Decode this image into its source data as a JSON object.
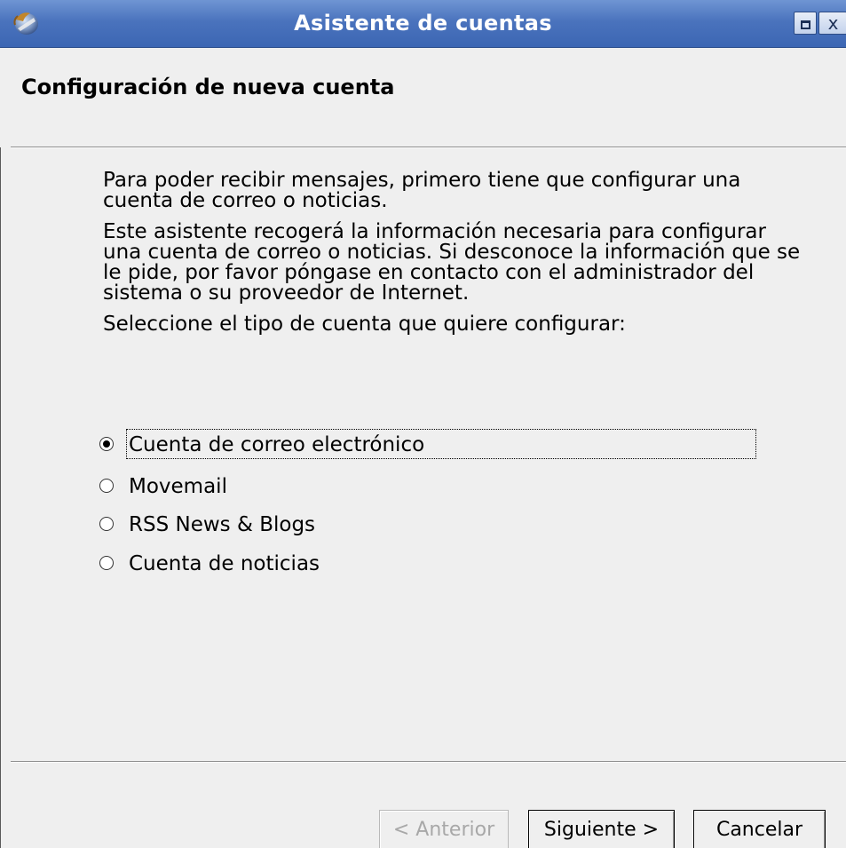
{
  "window": {
    "title": "Asistente de cuentas",
    "icon": "thunderbird-app-icon",
    "maximize_icon": "maximize-icon",
    "close_label": "x"
  },
  "header": {
    "title": "Configuración de nueva cuenta"
  },
  "content": {
    "intro": "Para poder recibir mensajes, primero tiene que configurar una cuenta de correo o noticias.",
    "description": "Este asistente recogerá la información necesaria para configurar una cuenta de correo o noticias. Si desconoce la información que se le pide, por favor póngase en contacto con el administrador del sistema o su proveedor de Internet.",
    "select_label": "Seleccione el tipo de cuenta que quiere configurar:"
  },
  "account_types": {
    "selected_index": 0,
    "options": [
      {
        "label": "Cuenta de correo electrónico",
        "checked": true
      },
      {
        "label": "Movemail",
        "checked": false
      },
      {
        "label": "RSS News & Blogs",
        "checked": false
      },
      {
        "label": "Cuenta de noticias",
        "checked": false
      }
    ]
  },
  "footer": {
    "back_label": "< Anterior",
    "back_enabled": false,
    "next_label": "Siguiente >",
    "cancel_label": "Cancelar"
  }
}
